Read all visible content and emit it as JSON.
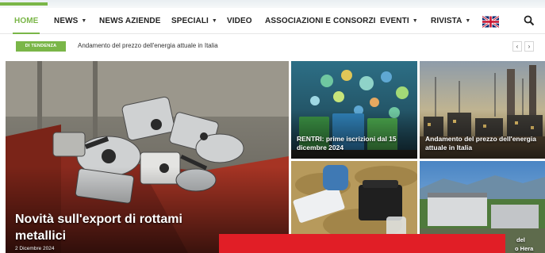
{
  "nav": {
    "items": [
      {
        "label": "HOME",
        "active": true,
        "dropdown": false
      },
      {
        "label": "NEWS",
        "dropdown": true
      },
      {
        "label": "NEWS AZIENDE",
        "dropdown": false
      },
      {
        "label": "SPECIALI",
        "dropdown": true
      },
      {
        "label": "VIDEO",
        "dropdown": false
      },
      {
        "label": "ASSOCIAZIONI E CONSORZI",
        "dropdown": false
      },
      {
        "label": "EVENTI",
        "dropdown": true
      },
      {
        "label": "RIVISTA",
        "dropdown": true
      }
    ],
    "language_icon": "uk-flag-icon",
    "search_icon": "search-icon"
  },
  "trending": {
    "badge": "DI TENDENZA",
    "headline": "Andamento del prezzo dell'energia attuale in Italia",
    "prev_icon": "‹",
    "next_icon": "›"
  },
  "featured": {
    "main": {
      "title": "Novità sull'export di rottami metallici",
      "date": "2 Dicembre 2024"
    },
    "tile_1": {
      "title": "RENTRI: prime iscrizioni dal 15 dicembre 2024"
    },
    "tile_2": {
      "title": "Andamento del prezzo dell'energia attuale in Italia"
    },
    "tile_3": {
      "title": ""
    },
    "tile_4": {
      "title_fragment_1": "del",
      "title_fragment_2": "o Hera"
    }
  },
  "colors": {
    "accent": "#7ab648",
    "ad_banner": "#e11e26"
  }
}
